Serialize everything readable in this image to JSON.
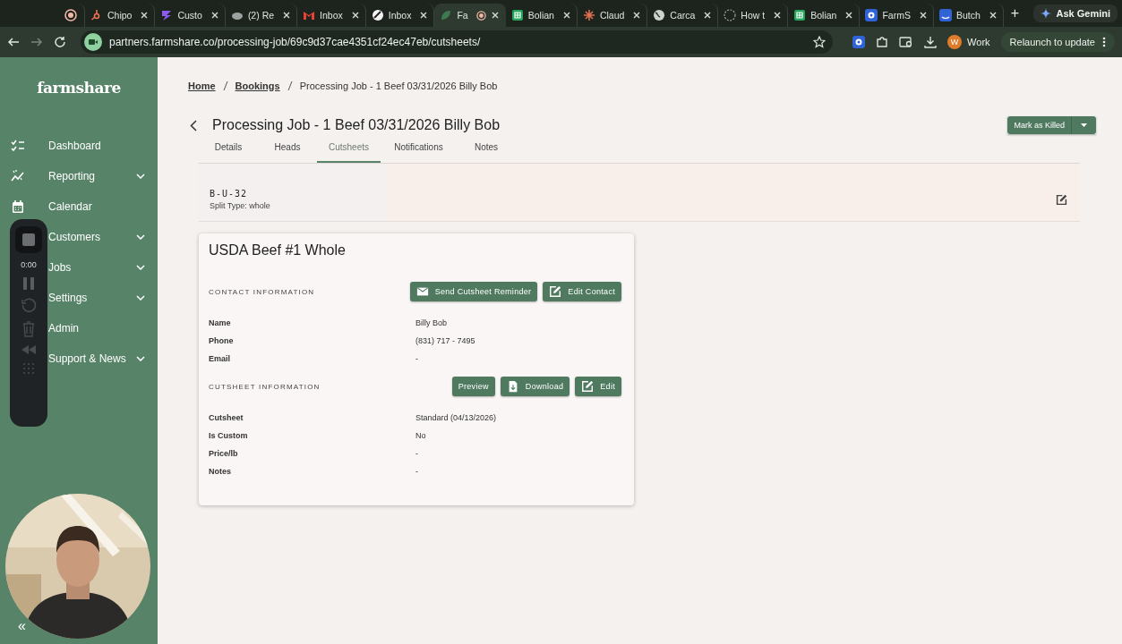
{
  "browser": {
    "tabs": [
      {
        "kind": "pinned",
        "selected": false,
        "recording": false
      },
      {
        "kind": "normal",
        "title": "Chipo",
        "selected": false,
        "recording": false
      },
      {
        "kind": "normal",
        "title": "Custo",
        "selected": false,
        "recording": false
      },
      {
        "kind": "normal",
        "title": "(2) Re",
        "selected": false,
        "recording": false
      },
      {
        "kind": "normal",
        "title": "Inbox",
        "selected": false,
        "recording": false
      },
      {
        "kind": "normal",
        "title": "Inbox",
        "selected": false,
        "recording": false
      },
      {
        "kind": "normal",
        "title": "Fa",
        "selected": true,
        "recording": true
      },
      {
        "kind": "normal",
        "title": "Bolian",
        "selected": false,
        "recording": false
      },
      {
        "kind": "normal",
        "title": "Claud",
        "selected": false,
        "recording": false
      },
      {
        "kind": "normal",
        "title": "Carca",
        "selected": false,
        "recording": false
      },
      {
        "kind": "normal",
        "title": "How t",
        "selected": false,
        "recording": false
      },
      {
        "kind": "normal",
        "title": "Bolian",
        "selected": false,
        "recording": false
      },
      {
        "kind": "normal",
        "title": "FarmS",
        "selected": false,
        "recording": false
      },
      {
        "kind": "normal",
        "title": "Butch",
        "selected": false,
        "recording": false
      }
    ],
    "new_tab": "+",
    "ask_gemini": "Ask Gemini",
    "url": "partners.farmshare.co/processing-job/69c9d37cae4351cf24ec47eb/cutsheets/",
    "profile": {
      "initial": "W",
      "name": "Work"
    },
    "relaunch": "Relaunch to update"
  },
  "sidebar": {
    "logo": "farmshare",
    "items": [
      {
        "label": "Dashboard",
        "expandable": false
      },
      {
        "label": "Reporting",
        "expandable": true
      },
      {
        "label": "Calendar",
        "expandable": false
      },
      {
        "label": "Customers",
        "expandable": true
      },
      {
        "label": "Jobs",
        "expandable": true
      },
      {
        "label": "Settings",
        "expandable": true
      },
      {
        "label": "Admin",
        "expandable": false
      },
      {
        "label": "Support & News",
        "expandable": true
      }
    ],
    "collapse": "«"
  },
  "recorder": {
    "time": "0:00"
  },
  "breadcrumb": [
    {
      "label": "Home",
      "link": true
    },
    {
      "label": "Bookings",
      "link": true
    },
    {
      "label": "Processing Job - 1 Beef 03/31/2026 Billy Bob",
      "link": false
    }
  ],
  "page": {
    "title": "Processing Job - 1 Beef 03/31/2026 Billy Bob",
    "action": "Mark as Killed",
    "tabs": [
      {
        "label": "Details",
        "selected": false
      },
      {
        "label": "Heads",
        "selected": false
      },
      {
        "label": "Cutsheets",
        "selected": true
      },
      {
        "label": "Notifications",
        "selected": false
      },
      {
        "label": "Notes",
        "selected": false
      }
    ]
  },
  "summary": {
    "code": "B-U-32",
    "split": "Split Type: whole"
  },
  "card": {
    "title": "USDA Beef #1 Whole",
    "sections": [
      {
        "heading": "CONTACT INFORMATION",
        "buttons": [
          {
            "label": "Send Cutsheet Reminder",
            "kind": "mail"
          },
          {
            "label": "Edit Contact",
            "kind": "edit"
          }
        ],
        "rows": [
          {
            "label": "Name",
            "value": "Billy Bob"
          },
          {
            "label": "Phone",
            "value": "(831) 717 - 7495"
          },
          {
            "label": "Email",
            "value": "-"
          }
        ]
      },
      {
        "heading": "CUTSHEET INFORMATION",
        "buttons": [
          {
            "label": "Preview",
            "kind": "plain"
          },
          {
            "label": "Download",
            "kind": "file"
          },
          {
            "label": "Edit",
            "kind": "edit"
          }
        ],
        "rows": [
          {
            "label": "Cutsheet",
            "value": "Standard (04/13/2026)"
          },
          {
            "label": "Is Custom",
            "value": "No"
          },
          {
            "label": "Price/lb",
            "value": "-"
          },
          {
            "label": "Notes",
            "value": "-"
          }
        ]
      }
    ]
  }
}
